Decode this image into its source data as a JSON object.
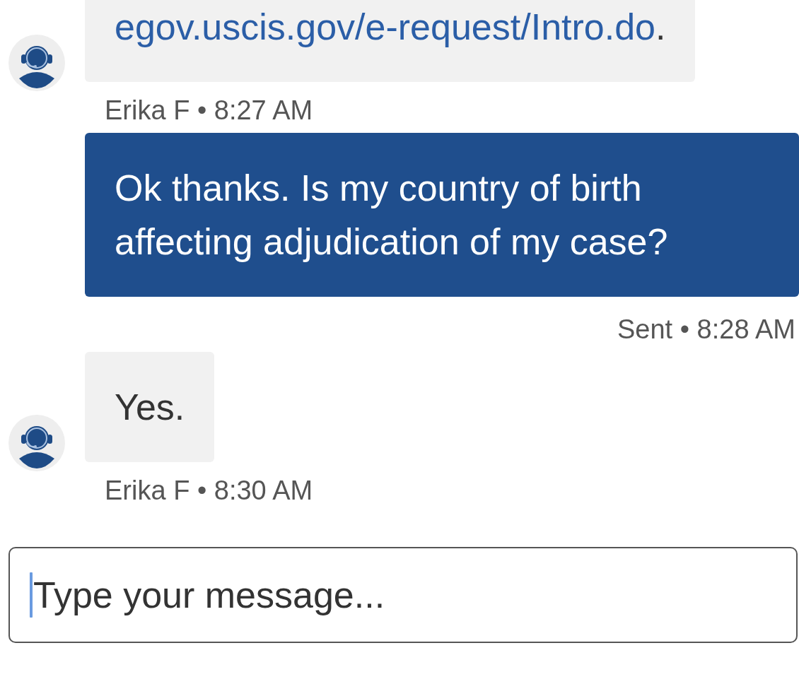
{
  "messages": [
    {
      "kind": "agent",
      "segments": [
        {
          "kind": "link",
          "text": "egov.uscis.gov/e-request/Intro.do"
        },
        {
          "kind": "plain",
          "text": "."
        }
      ],
      "meta": "Erika F • 8:27 AM"
    },
    {
      "kind": "user",
      "segments": [
        {
          "kind": "plain",
          "text": "Ok thanks. Is my country of birth affecting adjudication of my case?"
        }
      ],
      "meta": "Sent • 8:28 AM"
    },
    {
      "kind": "agent",
      "segments": [
        {
          "kind": "plain",
          "text": "Yes."
        }
      ],
      "meta": "Erika F • 8:30 AM"
    }
  ],
  "composer": {
    "placeholder": "Type your message...",
    "focused": true
  }
}
